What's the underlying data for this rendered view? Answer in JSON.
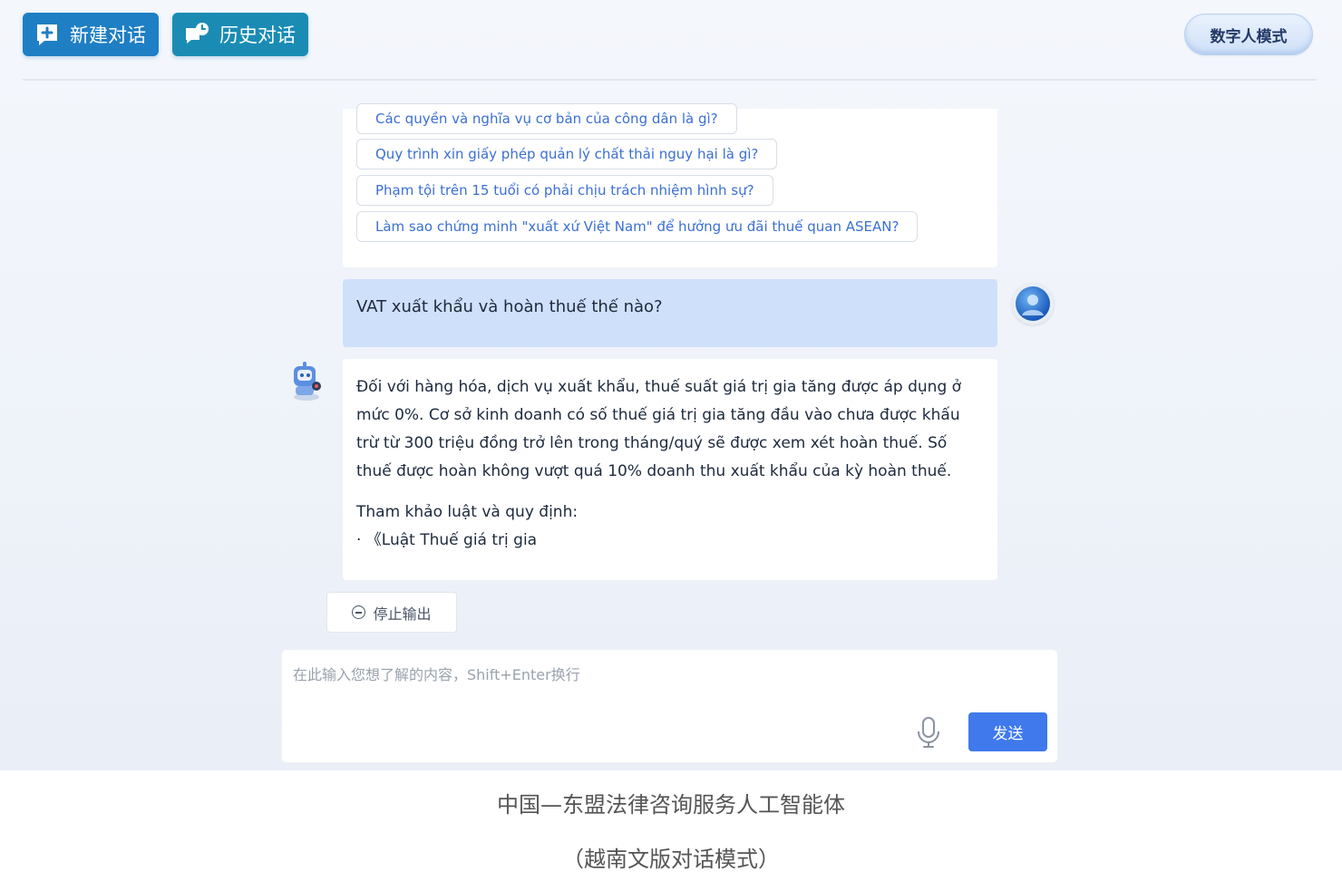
{
  "header": {
    "new_chat_label": "新建对话",
    "history_label": "历史对话",
    "digital_human_label": "数字人模式"
  },
  "suggestions": [
    "Các quyền và nghĩa vụ cơ bản của công dân là gì?",
    "Quy trình xin giấy phép quản lý chất thải nguy hại là gì?",
    "Phạm tội trên 15 tuổi có phải chịu trách nhiệm hình sự?",
    "Làm sao chứng minh \"xuất xứ Việt Nam\" để hưởng ưu đãi thuế quan ASEAN?"
  ],
  "user_message": "VAT xuất khẩu và hoàn thuế thế nào?",
  "bot_message": {
    "answer": "Đối với hàng hóa, dịch vụ xuất khẩu, thuế suất giá trị gia tăng được áp dụng ở mức 0%. Cơ sở kinh doanh có số thuế giá trị gia tăng đầu vào chưa được khấu trừ từ 300 triệu đồng trở lên trong tháng/quý sẽ được xem xét hoàn thuế. Số thuế được hoàn không vượt quá 10% doanh thu xuất khẩu của kỳ hoàn thuế.",
    "reference_heading": "Tham khảo luật và quy định:",
    "reference_item": "· 《Luật Thuế giá trị gia"
  },
  "stop_label": "停止输出",
  "input": {
    "placeholder": "在此输入您想了解的内容，Shift+Enter换行",
    "value": "",
    "send_label": "发送"
  },
  "caption": {
    "line1": "中国—东盟法律咨询服务人工智能体",
    "line2": "（越南文版对话模式）"
  },
  "colors": {
    "primary": "#1f7fc4",
    "user_bubble": "#cfe0fb",
    "send_button": "#3f79ec",
    "chip_text": "#3b6fd4"
  }
}
